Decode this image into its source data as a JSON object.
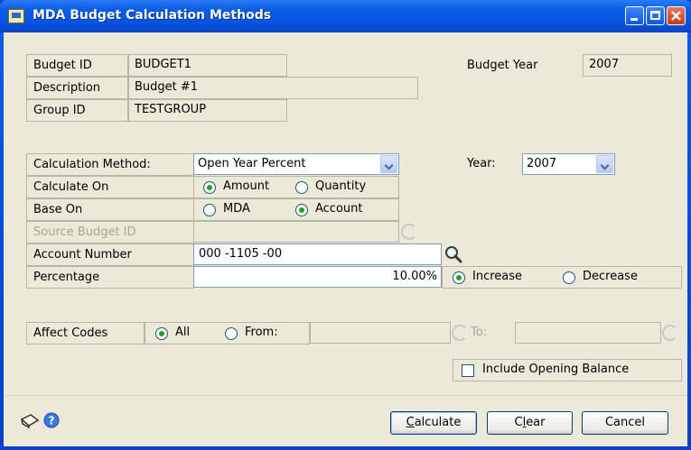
{
  "window": {
    "title": "MDA Budget Calculation Methods",
    "titlebar_buttons": [
      "minimize",
      "restore",
      "close"
    ]
  },
  "header": {
    "budget_id_label": "Budget ID",
    "budget_id_value": "BUDGET1",
    "description_label": "Description",
    "description_value": "Budget #1",
    "group_id_label": "Group ID",
    "group_id_value": "TESTGROUP",
    "budget_year_label": "Budget Year",
    "budget_year_value": "2007"
  },
  "form": {
    "calculation_method_label": "Calculation Method:",
    "calculation_method_value": "Open Year Percent",
    "year_label": "Year:",
    "year_value": "2007",
    "calculate_on_label": "Calculate On",
    "calculate_on_options": [
      {
        "label": "Amount",
        "checked": true
      },
      {
        "label": "Quantity",
        "checked": false
      }
    ],
    "base_on_label": "Base On",
    "base_on_options": [
      {
        "label": "MDA",
        "checked": false
      },
      {
        "label": "Account",
        "checked": true
      }
    ],
    "source_budget_id_label": "Source Budget ID",
    "source_budget_id_value": "",
    "account_number_label": "Account Number",
    "account_number_value": "000 -1105 -00",
    "percentage_label": "Percentage",
    "percentage_value": "10.00%",
    "direction_options": [
      {
        "label": "Increase",
        "checked": true
      },
      {
        "label": "Decrease",
        "checked": false
      }
    ],
    "affect_codes_label": "Affect Codes",
    "affect_codes_options": [
      {
        "label": "All",
        "checked": true
      },
      {
        "label": "From:",
        "checked": false
      }
    ],
    "to_label": "To:",
    "include_opening_balance_label": "Include Opening Balance",
    "include_opening_balance_checked": false
  },
  "footer": {
    "calculate_label_pre": "",
    "calculate_label_ul": "C",
    "calculate_label_post": "alculate",
    "clear_label_pre": "C",
    "clear_label_ul": "l",
    "clear_label_post": "ear",
    "cancel_label": "Cancel"
  },
  "icons": {
    "note": "note-icon",
    "help": "help-icon",
    "lookup": "magnifier-icon"
  }
}
